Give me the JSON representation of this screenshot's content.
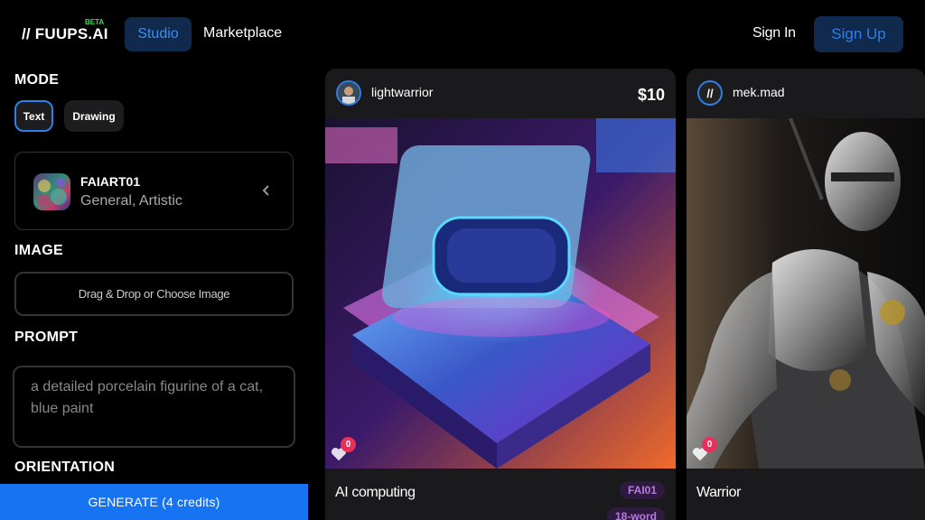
{
  "header": {
    "logo": "// FUUPS.AI",
    "beta": "BETA",
    "nav": {
      "studio": "Studio",
      "marketplace": "Marketplace"
    },
    "sign_in": "Sign In",
    "sign_up": "Sign Up"
  },
  "sidebar": {
    "mode_label": "MODE",
    "modes": [
      {
        "label": "Text",
        "active": true
      },
      {
        "label": "Drawing",
        "active": false
      }
    ],
    "model": {
      "name": "FAIART01",
      "categories": "General, Artistic"
    },
    "image_label": "IMAGE",
    "drop_zone": "Drag & Drop or Choose Image",
    "prompt_label": "PROMPT",
    "prompt_placeholder": "a detailed porcelain figurine of a cat, blue paint",
    "orientation_label": "ORIENTATION",
    "generate": "GENERATE (4 credits)"
  },
  "cards": [
    {
      "username": "lightwarrior",
      "price": "$10",
      "likes": "0",
      "title": "AI computing",
      "tags": [
        "FAI01",
        "18-word"
      ]
    },
    {
      "username": "mek.mad",
      "avatar_text": "//",
      "likes": "0",
      "title": "Warrior"
    }
  ],
  "colors": {
    "accent": "#1673f2",
    "nav_active_bg": "#0f2a4d",
    "beta": "#3ddc4a",
    "like_badge": "#e8305c",
    "tag_text": "#b77ae0"
  }
}
